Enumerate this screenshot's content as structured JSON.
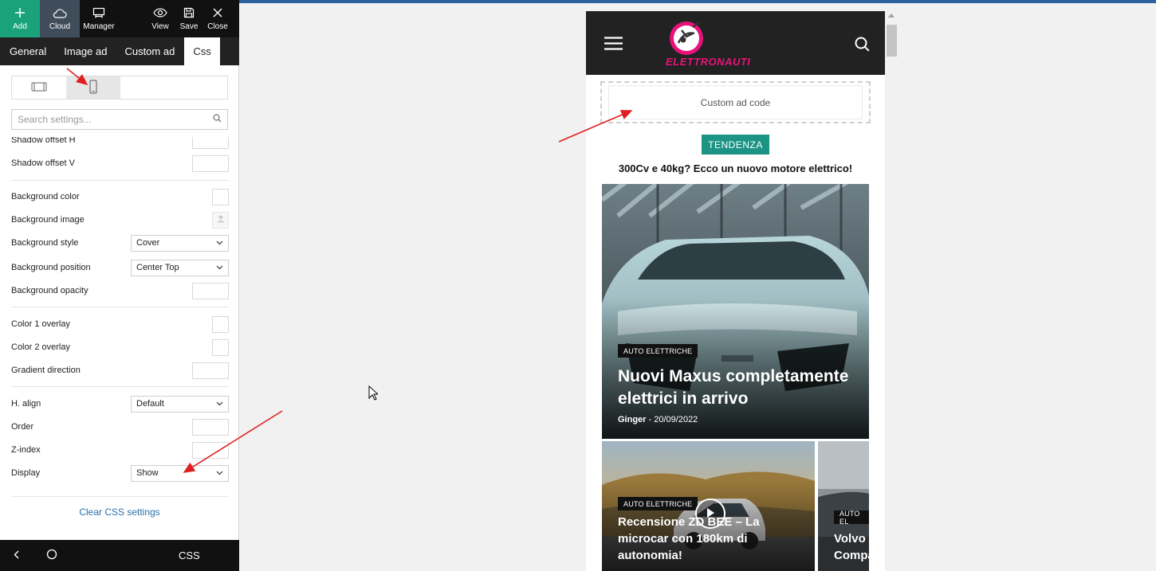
{
  "toolbar": {
    "add": "Add",
    "cloud": "Cloud",
    "manager": "Manager",
    "view": "View",
    "save": "Save",
    "close": "Close"
  },
  "tabs": [
    "General",
    "Image ad",
    "Custom ad",
    "Css"
  ],
  "search": {
    "placeholder": "Search settings..."
  },
  "settings": {
    "shadow_offset_h": "Shadow offset H",
    "shadow_offset_v": "Shadow offset V",
    "background_color": "Background color",
    "background_image": "Background image",
    "background_style": "Background style",
    "background_style_value": "Cover",
    "background_position": "Background position",
    "background_position_value": "Center Top",
    "background_opacity": "Background opacity",
    "color1_overlay": "Color 1 overlay",
    "color2_overlay": "Color 2 overlay",
    "gradient_direction": "Gradient direction",
    "h_align": "H. align",
    "h_align_value": "Default",
    "order": "Order",
    "z_index": "Z-index",
    "display": "Display",
    "display_value": "Show"
  },
  "clear_css": "Clear CSS settings",
  "bottombar": {
    "title": "CSS"
  },
  "site": {
    "logo_text": "ELETTRONAUTI",
    "ad_placeholder": "Custom ad code",
    "trending_label": "TENDENZA",
    "trending_headline": "300Cv e 40kg? Ecco un nuovo motore elettrico!",
    "hero": {
      "category": "AUTO ELETTRICHE",
      "title": "Nuovi Maxus completamente elettrici in arrivo",
      "author": "Ginger",
      "separator": "-",
      "date": "20/09/2022"
    },
    "card2": {
      "category": "AUTO ELETTRICHE",
      "title": "Recensione ZD BEE – La microcar con 180km di autonomia!"
    },
    "card3": {
      "category": "AUTO EL",
      "title": "Volvo Compa"
    }
  },
  "colors": {
    "toolbar_bg": "#111111",
    "add_bg": "#1aa37a",
    "cloud_bg": "#3f4c5a",
    "trending_bg": "#1b9485",
    "logo_pink": "#e8127c",
    "link_blue": "#2a6fa8",
    "annotation_red": "#e02020"
  }
}
